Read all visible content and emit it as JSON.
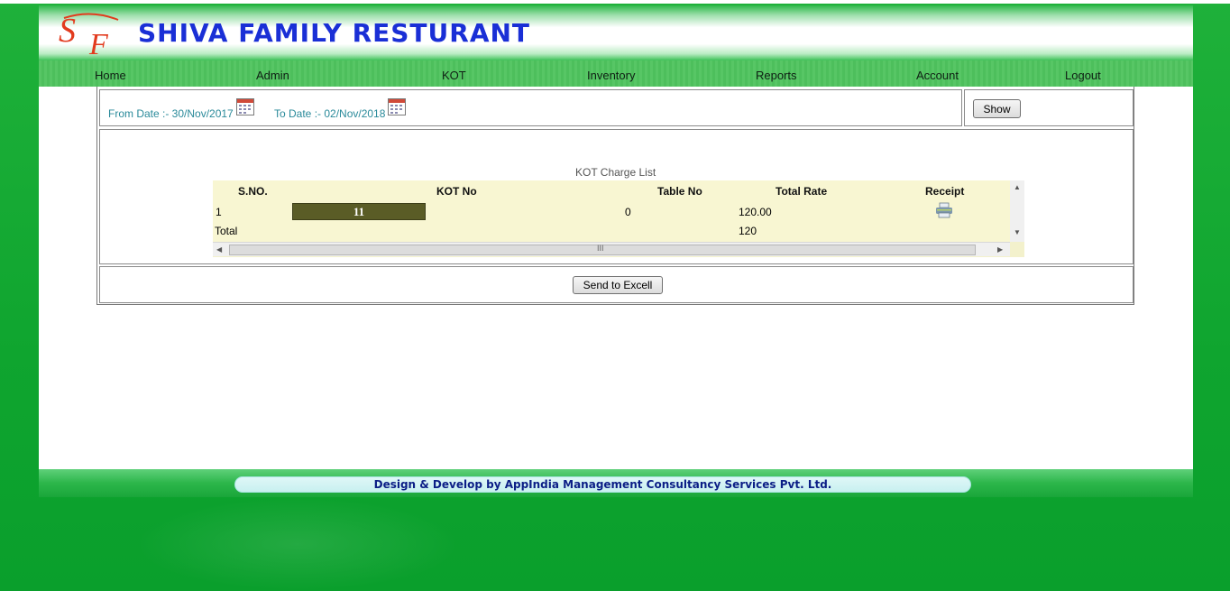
{
  "app": {
    "brand_title": "SHIVA FAMILY RESTURANT",
    "logo_letters": "SF"
  },
  "nav": {
    "items": [
      "Home",
      "Admin",
      "KOT",
      "Inventory",
      "Reports",
      "Account",
      "Logout"
    ]
  },
  "filters": {
    "from_date": "From Date :- 30/Nov/2017",
    "to_date": "To Date :- 02/Nov/2018",
    "show_label": "Show"
  },
  "grid": {
    "caption": "KOT Charge List",
    "columns": [
      "S.NO.",
      "KOT No",
      "Table No",
      "Total Rate",
      "Receipt"
    ],
    "rows": [
      {
        "sno": "1",
        "kot_no": "11",
        "table_no": "0",
        "total_rate": "120.00",
        "receipt_icon": "printer-icon"
      }
    ],
    "total_label": "Total",
    "total_value": "120",
    "scroll_grip": "III"
  },
  "actions": {
    "excel_label": "Send to Excell"
  },
  "footer": {
    "credit": "Design & Develop by AppIndia Management Consultancy Services Pvt. Ltd."
  },
  "colors": {
    "background_green": "#0fa52f",
    "brand_blue": "#1a2fd6",
    "logo_red": "#e23b1e",
    "label_teal": "#2a8a9a",
    "grid_bg": "#f8f6d2",
    "kot_button": "#5a5c26",
    "footer_text": "#0b1e86"
  }
}
